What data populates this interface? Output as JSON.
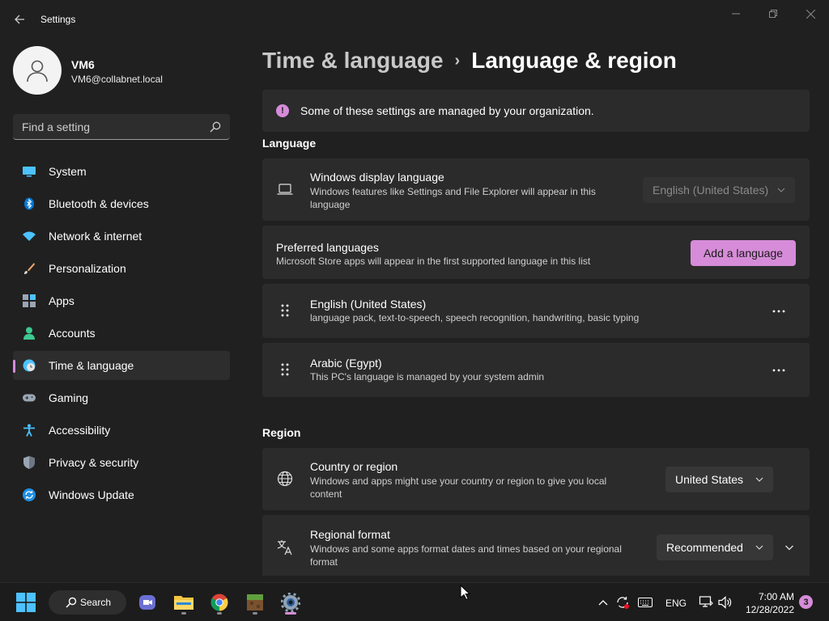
{
  "window": {
    "title": "Settings"
  },
  "user": {
    "name": "VM6",
    "email": "VM6@collabnet.local"
  },
  "search": {
    "placeholder": "Find a setting"
  },
  "sidebar": {
    "items": [
      {
        "label": "System",
        "icon": "system-icon"
      },
      {
        "label": "Bluetooth & devices",
        "icon": "bluetooth-icon"
      },
      {
        "label": "Network & internet",
        "icon": "wifi-icon"
      },
      {
        "label": "Personalization",
        "icon": "brush-icon"
      },
      {
        "label": "Apps",
        "icon": "apps-icon"
      },
      {
        "label": "Accounts",
        "icon": "person-icon"
      },
      {
        "label": "Time & language",
        "icon": "clock-globe-icon",
        "active": true
      },
      {
        "label": "Gaming",
        "icon": "gamepad-icon"
      },
      {
        "label": "Accessibility",
        "icon": "accessibility-icon"
      },
      {
        "label": "Privacy & security",
        "icon": "shield-icon"
      },
      {
        "label": "Windows Update",
        "icon": "update-icon"
      }
    ]
  },
  "breadcrumb": {
    "parent": "Time & language",
    "separator": "›",
    "current": "Language & region"
  },
  "info_bar": {
    "text": "Some of these settings are managed by your organization."
  },
  "language_section": {
    "title": "Language",
    "display_language": {
      "title": "Windows display language",
      "description": "Windows features like Settings and File Explorer will appear in this language",
      "value": "English (United States)",
      "disabled": true
    },
    "preferred": {
      "title": "Preferred languages",
      "description": "Microsoft Store apps will appear in the first supported language in this list",
      "button": "Add a language"
    },
    "languages": [
      {
        "name": "English (United States)",
        "detail": "language pack, text-to-speech, speech recognition, handwriting, basic typing"
      },
      {
        "name": "Arabic (Egypt)",
        "detail": "This PC's language is managed by your system admin"
      }
    ]
  },
  "region_section": {
    "title": "Region",
    "country": {
      "title": "Country or region",
      "description": "Windows and apps might use your country or region to give you local content",
      "value": "United States"
    },
    "format": {
      "title": "Regional format",
      "description": "Windows and some apps format dates and times based on your regional format",
      "value": "Recommended"
    }
  },
  "taskbar": {
    "search_label": "Search",
    "pinned": [
      "start-icon",
      "search-icon",
      "teams-icon",
      "file-explorer-icon",
      "chrome-icon",
      "minecraft-icon",
      "settings-icon"
    ],
    "language_indicator": "ENG",
    "time": "7:00 AM",
    "date": "12/28/2022",
    "notification_count": "3"
  },
  "colors": {
    "accent": "#d68cd8",
    "background": "#202020",
    "card": "#2b2b2b",
    "taskbar": "#1c1c1c"
  }
}
